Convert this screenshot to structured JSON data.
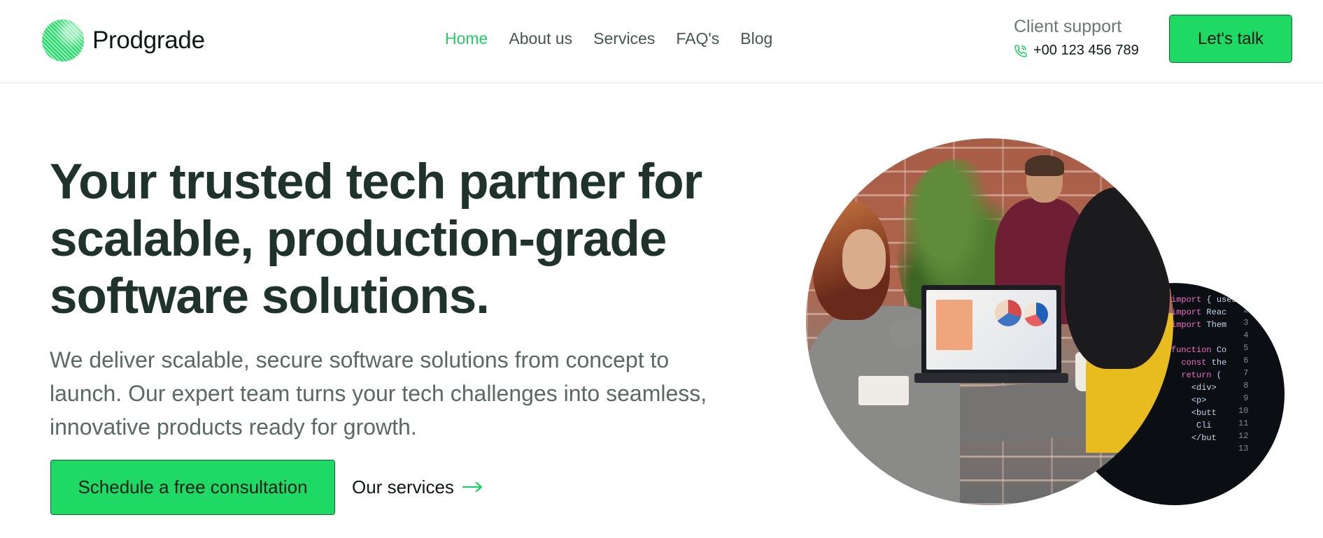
{
  "brand": {
    "name": "Prodgrade",
    "accent_color": "#1fd965",
    "nav_active_color": "#1fcf62",
    "title_color": "#1f332c"
  },
  "nav": {
    "items": [
      {
        "label": "Home",
        "active": true
      },
      {
        "label": "About us",
        "active": false
      },
      {
        "label": "Services",
        "active": false
      },
      {
        "label": "FAQ's",
        "active": false
      },
      {
        "label": "Blog",
        "active": false
      }
    ]
  },
  "support": {
    "label": "Client support",
    "phone": "+00 123 456 789",
    "icon": "phone-icon"
  },
  "header_cta": {
    "label": "Let's talk"
  },
  "hero": {
    "title_lines": [
      "Your trusted tech partner for",
      "scalable, production-grade",
      "software solutions."
    ],
    "subtitle_lines": [
      "We deliver scalable, secure software solutions from concept to",
      "launch. Our expert team turns your tech challenges into seamless,",
      "innovative products ready for growth."
    ],
    "primary_cta": "Schedule a free consultation",
    "secondary_cta": "Our services",
    "secondary_icon": "arrow-right-icon"
  },
  "images": {
    "team_photo": "team-collaboration-photo",
    "code_photo": "code-editor-photo"
  }
}
